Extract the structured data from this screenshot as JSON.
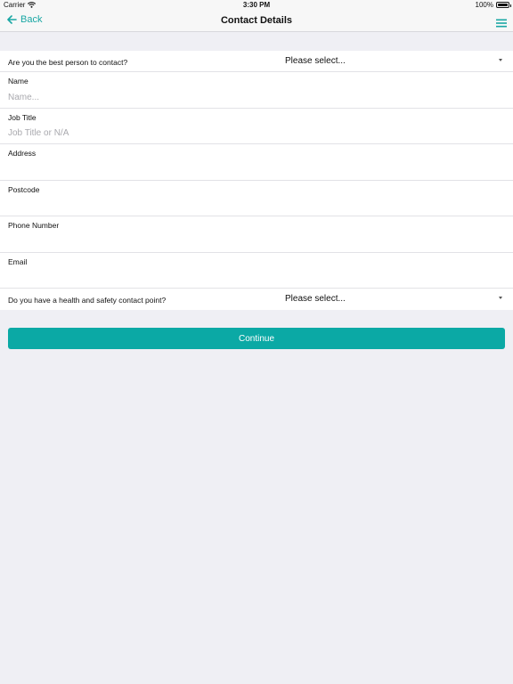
{
  "status_bar": {
    "carrier": "Carrier",
    "time": "3:30 PM",
    "battery": "100%"
  },
  "nav": {
    "back_label": "Back",
    "title": "Contact Details",
    "back_icon": "arrow-left-icon",
    "menu_icon": "hamburger-menu-icon"
  },
  "form": {
    "best_person_question": "Are you the best person to contact?",
    "best_person_value": "Please select...",
    "name_label": "Name",
    "name_placeholder": "Name...",
    "job_title_label": "Job Title",
    "job_title_placeholder": "Job Title or N/A",
    "address_label": "Address",
    "postcode_label": "Postcode",
    "phone_label": "Phone Number",
    "email_label": "Email",
    "health_safety_question": "Do you have a health and safety contact point?",
    "health_safety_value": "Please select..."
  },
  "continue_label": "Continue",
  "colors": {
    "accent": "#0ba9a5",
    "background": "#efeff4",
    "nav_background": "#f7f7f7"
  }
}
